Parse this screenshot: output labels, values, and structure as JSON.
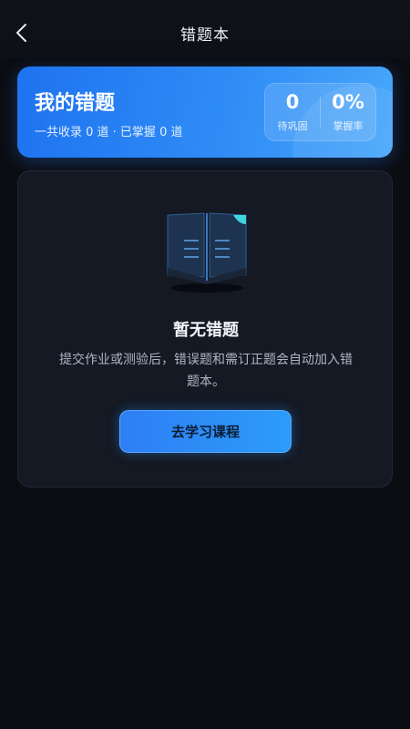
{
  "header": {
    "title": "错题本"
  },
  "summary": {
    "title": "我的错题",
    "subtitle": "一共收录 0 道 · 已掌握 0 道",
    "stats": [
      {
        "value": "0",
        "label": "待巩固"
      },
      {
        "value": "0%",
        "label": "掌握率"
      }
    ]
  },
  "empty_state": {
    "title": "暂无错题",
    "description": "提交作业或测验后，错误题和需订正题会自动加入错题本。",
    "button_label": "去学习课程"
  },
  "colors": {
    "background": "#0b0d12",
    "accent": "#2f8cf6",
    "card": "#141923"
  },
  "icons": [
    "back-arrow-icon",
    "open-book-icon"
  ]
}
